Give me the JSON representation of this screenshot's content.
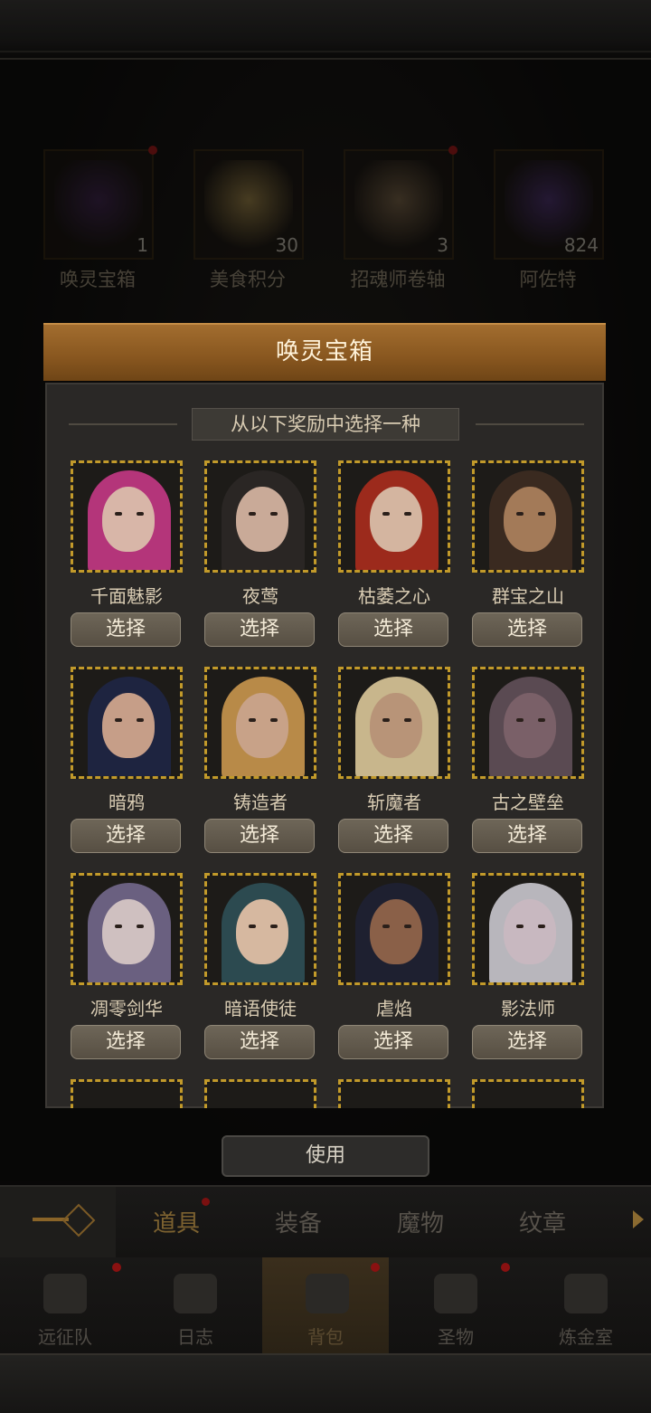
{
  "inventory": [
    {
      "name": "唤灵宝箱",
      "count": "1",
      "badge": true,
      "art_color": "#4a2b5e",
      "icon": "chest-icon"
    },
    {
      "name": "美食积分",
      "count": "30",
      "badge": false,
      "art_color": "#b89a52",
      "icon": "star-icon"
    },
    {
      "name": "招魂师卷轴",
      "count": "3",
      "badge": true,
      "art_color": "#8d7352",
      "icon": "scroll-icon"
    },
    {
      "name": "阿佐特",
      "count": "824",
      "badge": false,
      "art_color": "#5a3a86",
      "icon": "potion-icon"
    }
  ],
  "dialog": {
    "title": "唤灵宝箱",
    "prompt": "从以下奖励中选择一种",
    "select_label": "选择",
    "heroes": [
      {
        "name": "千面魅影",
        "hair": "#b4357a",
        "skin": "#d8b6a8"
      },
      {
        "name": "夜莺",
        "hair": "#2a2624",
        "skin": "#c9aa98"
      },
      {
        "name": "枯萎之心",
        "hair": "#9c2a1c",
        "skin": "#d4b5a0"
      },
      {
        "name": "群宝之山",
        "hair": "#3a2a20",
        "skin": "#a37a58"
      },
      {
        "name": "暗鸦",
        "hair": "#1e2440",
        "skin": "#c69e88"
      },
      {
        "name": "铸造者",
        "hair": "#b88a48",
        "skin": "#c8a288"
      },
      {
        "name": "斩魔者",
        "hair": "#c8b68c",
        "skin": "#b89478"
      },
      {
        "name": "古之壁垒",
        "hair": "#5a4a52",
        "skin": "#7a6068"
      },
      {
        "name": "凋零剑华",
        "hair": "#6a6080",
        "skin": "#cfc0c0"
      },
      {
        "name": "暗语使徒",
        "hair": "#2c4a50",
        "skin": "#d6b8a0"
      },
      {
        "name": "虐焰",
        "hair": "#1e2030",
        "skin": "#8a6048"
      },
      {
        "name": "影法师",
        "hair": "#b8b6bc",
        "skin": "#c8b8c0"
      }
    ]
  },
  "use_label": "使用",
  "categories": {
    "tabs": [
      {
        "label": "道具",
        "active": true,
        "badge": true
      },
      {
        "label": "装备",
        "active": false,
        "badge": false
      },
      {
        "label": "魔物",
        "active": false,
        "badge": false
      },
      {
        "label": "纹章",
        "active": false,
        "badge": false
      }
    ]
  },
  "nav": [
    {
      "label": "远征队",
      "badge": true,
      "icon": "helmet-icon",
      "active": false
    },
    {
      "label": "日志",
      "badge": false,
      "icon": "journal-icon",
      "active": false
    },
    {
      "label": "背包",
      "badge": true,
      "icon": "backpack-icon",
      "active": true
    },
    {
      "label": "圣物",
      "badge": true,
      "icon": "relic-icon",
      "active": false
    },
    {
      "label": "炼金室",
      "badge": false,
      "icon": "alchemy-icon",
      "active": false
    }
  ]
}
